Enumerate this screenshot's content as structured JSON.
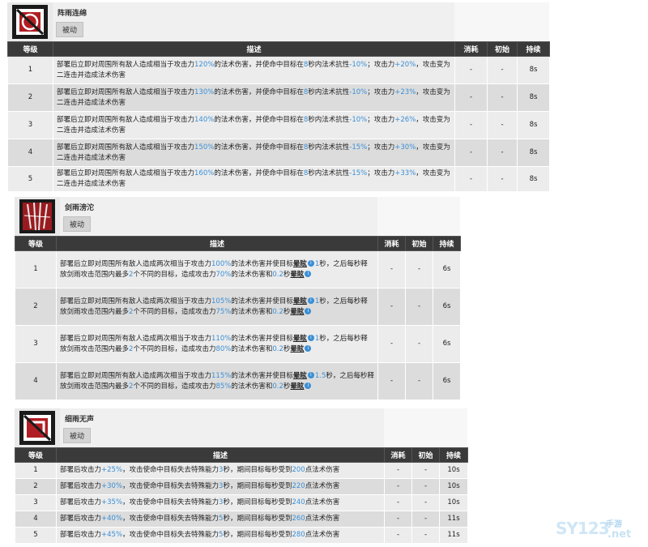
{
  "headers": {
    "level": "等级",
    "desc": "描述",
    "cost": "消耗",
    "init": "初始",
    "dur": "持续"
  },
  "skills": [
    {
      "name": "阵雨连绵",
      "tag": "被动",
      "rows": [
        {
          "level": "1",
          "desc": "部署后立即对周围所有敌人造成相当于攻击力120%的法术伤害，并使命中目标在8秒内法术抗性-10%；攻击力+20%，攻击变为二连击并造成法术伤害",
          "cost": "-",
          "init": "-",
          "dur": "8s"
        },
        {
          "level": "2",
          "desc": "部署后立即对周围所有敌人造成相当于攻击力130%的法术伤害，并使命中目标在8秒内法术抗性-10%；攻击力+23%，攻击变为二连击并造成法术伤害",
          "cost": "-",
          "init": "-",
          "dur": "8s"
        },
        {
          "level": "3",
          "desc": "部署后立即对周围所有敌人造成相当于攻击力140%的法术伤害，并使命中目标在8秒内法术抗性-10%；攻击力+26%，攻击变为二连击并造成法术伤害",
          "cost": "-",
          "init": "-",
          "dur": "8s"
        },
        {
          "level": "4",
          "desc": "部署后立即对周围所有敌人造成相当于攻击力150%的法术伤害，并使命中目标在8秒内法术抗性-15%；攻击力+30%，攻击变为二连击并造成法术伤害",
          "cost": "-",
          "init": "-",
          "dur": "8s"
        },
        {
          "level": "5",
          "desc": "部署后立即对周围所有敌人造成相当于攻击力160%的法术伤害，并使命中目标在8秒内法术抗性-15%；攻击力+33%，攻击变为二连击并造成法术伤害",
          "cost": "-",
          "init": "-",
          "dur": "8s"
        }
      ]
    },
    {
      "name": "剑雨滂沱",
      "tag": "被动",
      "rows": [
        {
          "level": "1",
          "desc": "部署后立即对周围所有敌人造成两次相当于攻击力100%的法术伤害并使目标晕眩1秒，之后每秒释放剑雨攻击范围内最多2个不同的目标，造成攻击力70%的法术伤害和0.2秒晕眩",
          "cost": "-",
          "init": "-",
          "dur": "6s"
        },
        {
          "level": "2",
          "desc": "部署后立即对周围所有敌人造成两次相当于攻击力105%的法术伤害并使目标晕眩1秒，之后每秒释放剑雨攻击范围内最多2个不同的目标，造成攻击力75%的法术伤害和0.2秒晕眩",
          "cost": "-",
          "init": "-",
          "dur": "6s"
        },
        {
          "level": "3",
          "desc": "部署后立即对周围所有敌人造成两次相当于攻击力110%的法术伤害并使目标晕眩1秒，之后每秒释放剑雨攻击范围内最多2个不同的目标，造成攻击力80%的法术伤害和0.2秒晕眩",
          "cost": "-",
          "init": "-",
          "dur": "6s"
        },
        {
          "level": "4",
          "desc": "部署后立即对周围所有敌人造成两次相当于攻击力115%的法术伤害并使目标晕眩1.5秒，之后每秒释放剑雨攻击范围内最多2个不同的目标，造成攻击力85%的法术伤害和0.2秒晕眩",
          "cost": "-",
          "init": "-",
          "dur": "6s"
        }
      ]
    },
    {
      "name": "细雨无声",
      "tag": "被动",
      "rows": [
        {
          "level": "1",
          "desc": "部署后攻击力+25%，攻击使命中目标失去特殊能力3秒，期间目标每秒受到200点法术伤害",
          "cost": "-",
          "init": "-",
          "dur": "10s"
        },
        {
          "level": "2",
          "desc": "部署后攻击力+30%，攻击使命中目标失去特殊能力3秒，期间目标每秒受到220点法术伤害",
          "cost": "-",
          "init": "-",
          "dur": "10s"
        },
        {
          "level": "3",
          "desc": "部署后攻击力+35%，攻击使命中目标失去特殊能力3秒，期间目标每秒受到240点法术伤害",
          "cost": "-",
          "init": "-",
          "dur": "10s"
        },
        {
          "level": "4",
          "desc": "部署后攻击力+40%，攻击使命中目标失去特殊能力5秒，期间目标每秒受到260点法术伤害",
          "cost": "-",
          "init": "-",
          "dur": "11s"
        },
        {
          "level": "5",
          "desc": "部署后攻击力+45%，攻击使命中目标失去特殊能力5秒，期间目标每秒受到280点法术伤害",
          "cost": "-",
          "init": "-",
          "dur": "11s"
        }
      ]
    }
  ],
  "watermark": {
    "main": "SY123",
    "sub1": "手游",
    "sub2": ".net"
  },
  "colors": {
    "highlight": "#3a8fd6",
    "header_bg": "#3a3a3a",
    "row_light": "#ececec",
    "row_dark": "#dcdcdc"
  }
}
